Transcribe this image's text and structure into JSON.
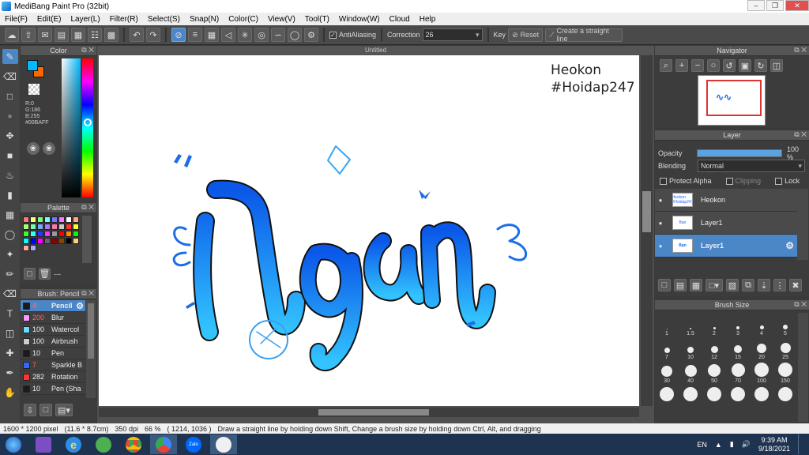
{
  "window": {
    "title": "MediBang Paint Pro (32bit)"
  },
  "menu": [
    "File(F)",
    "Edit(E)",
    "Layer(L)",
    "Filter(R)",
    "Select(S)",
    "Snap(N)",
    "Color(C)",
    "View(V)",
    "Tool(T)",
    "Window(W)",
    "Cloud",
    "Help"
  ],
  "toolbar": {
    "antialiasing_label": "AntiAliasing",
    "correction_label": "Correction",
    "correction_value": "26",
    "key_label": "Key",
    "reset_label": "Reset",
    "straight_line_label": "Create a straight line"
  },
  "color_panel": {
    "title": "Color",
    "r": "R:0",
    "g": "G:186",
    "b": "B:255",
    "hex": "#00BAFF",
    "main_color": "#00BAFF",
    "sub_color": "#FF6600"
  },
  "palette_panel": {
    "title": "Palette",
    "footer_text": "---",
    "colors": [
      "#ff7777",
      "#ffff77",
      "#77ff77",
      "#77ffff",
      "#7777ff",
      "#ff77ff",
      "#ffffff",
      "#ffaa77",
      "#aaff77",
      "#77ffaa",
      "#77aaff",
      "#aa77ff",
      "#ff77aa",
      "#cccccc",
      "#ff3333",
      "#ffff33",
      "#33ff33",
      "#33ffff",
      "#3333ff",
      "#ff33ff",
      "#999999",
      "#ff0000",
      "#ff8800",
      "#00ff00",
      "#00ffff",
      "#0000ff",
      "#ff00ff",
      "#666666",
      "#880000",
      "#884400",
      "#000000",
      "#ffcc88",
      "#ffaaaa",
      "#aaaaff"
    ]
  },
  "brush_panel": {
    "title": "Brush: Pencil",
    "items": [
      {
        "size": "4",
        "name": "Pencil",
        "color": "#1a1a1a",
        "size_color": "#ff6666"
      },
      {
        "size": "200",
        "name": "Blur",
        "color": "#ff99ff",
        "size_color": "#ff6666"
      },
      {
        "size": "100",
        "name": "Watercol",
        "color": "#66ddff",
        "size_color": "#eeeeee"
      },
      {
        "size": "100",
        "name": "Airbrush",
        "color": "#cccccc",
        "size_color": "#eeeeee"
      },
      {
        "size": "10",
        "name": "Pen",
        "color": "#1a1a1a",
        "size_color": "#eeeeee"
      },
      {
        "size": "7",
        "name": "Sparkle B",
        "color": "#3366ff",
        "size_color": "#ff6666"
      },
      {
        "size": "282",
        "name": "Rotation",
        "color": "#ff3333",
        "size_color": "#eeeeee"
      },
      {
        "size": "10",
        "name": "Pen (Sha",
        "color": "#1a1a1a",
        "size_color": "#eeeeee"
      }
    ]
  },
  "canvas": {
    "tab_title": "Untitled",
    "text_line1": "Heokon",
    "text_line2": "#Hoidap247"
  },
  "navigator": {
    "title": "Navigator"
  },
  "layer_panel": {
    "title": "Layer",
    "opacity_label": "Opacity",
    "opacity_value": "100 %",
    "opacity": 1.0,
    "blending_label": "Blending",
    "blending_value": "Normal",
    "protect_alpha": "Protect Alpha",
    "clipping": "Clipping",
    "lock": "Lock",
    "layers": [
      {
        "name": "Heokon",
        "thumb": "Heokon #Hoidap247"
      },
      {
        "name": "Layer1",
        "thumb": "Bạn"
      },
      {
        "name": "Layer1",
        "thumb": "Bạn"
      }
    ]
  },
  "brush_size_panel": {
    "title": "Brush Size",
    "sizes": [
      "1",
      "1.5",
      "2",
      "3",
      "4",
      "5",
      "7",
      "10",
      "12",
      "15",
      "20",
      "25",
      "30",
      "40",
      "50",
      "70",
      "100",
      "150",
      "",
      "",
      "",
      "",
      "",
      ""
    ]
  },
  "status": {
    "dimensions": "1600 * 1200 pixel",
    "physical": "(11.6 * 8.7cm)",
    "dpi": "350 dpi",
    "zoom": "66 %",
    "coords": "( 1214, 1036 )",
    "hint": "Draw a straight line by holding down Shift, Change a brush size by holding down Ctrl, Alt, and dragging"
  },
  "taskbar": {
    "language": "EN",
    "time": "9:39 AM",
    "date": "9/18/2021",
    "zalo_label": "Zalo"
  }
}
